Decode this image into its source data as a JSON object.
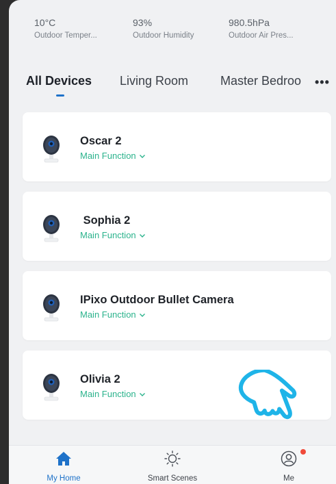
{
  "weather": [
    {
      "value": "10°C",
      "label": "Outdoor Temper..."
    },
    {
      "value": "93%",
      "label": "Outdoor Humidity"
    },
    {
      "value": "980.5hPa",
      "label": "Outdoor Air Pres..."
    }
  ],
  "tabs": [
    {
      "label": "All Devices",
      "active": true
    },
    {
      "label": "Living Room",
      "active": false
    },
    {
      "label": "Master Bedroo",
      "active": false
    }
  ],
  "more_label": "•••",
  "devices": [
    {
      "name": "Oscar 2",
      "function": "Main Function"
    },
    {
      "name": " Sophia 2",
      "function": "Main Function"
    },
    {
      "name": "IPixo Outdoor Bullet Camera",
      "function": "Main Function"
    },
    {
      "name": "Olivia 2",
      "function": "Main Function"
    }
  ],
  "bottom_nav": [
    {
      "label": "My Home",
      "icon": "home-icon",
      "active": true
    },
    {
      "label": "Smart Scenes",
      "icon": "sun-icon",
      "active": false
    },
    {
      "label": "Me",
      "icon": "profile-icon",
      "active": false,
      "badge": true
    }
  ],
  "colors": {
    "accent": "#1e72c9",
    "function_text": "#2bb38c",
    "badge": "#f04a3a",
    "pointer_hand": "#1fb4e8"
  }
}
